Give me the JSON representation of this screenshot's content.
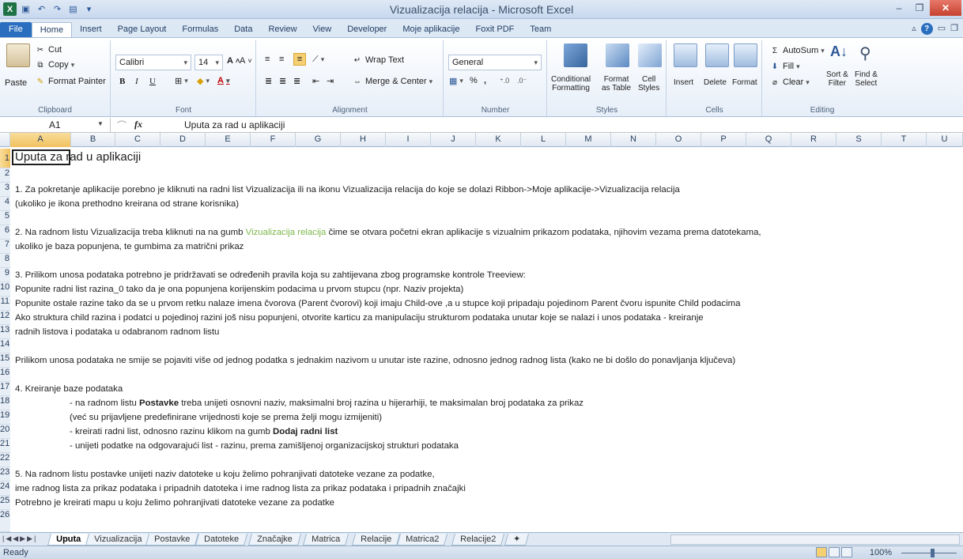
{
  "window": {
    "title": "Vizualizacija relacija  -  Microsoft Excel"
  },
  "ribbon_tabs": [
    "File",
    "Home",
    "Insert",
    "Page Layout",
    "Formulas",
    "Data",
    "Review",
    "View",
    "Developer",
    "Moje aplikacije",
    "Foxit PDF",
    "Team"
  ],
  "active_tab": "Home",
  "clipboard": {
    "paste": "Paste",
    "cut": "Cut",
    "copy": "Copy",
    "format_painter": "Format Painter",
    "label": "Clipboard"
  },
  "font": {
    "name": "Calibri",
    "size": "14",
    "label": "Font",
    "bold": "B",
    "italic": "I",
    "underline": "U"
  },
  "alignment": {
    "wrap_text": "Wrap Text",
    "merge_center": "Merge & Center",
    "label": "Alignment"
  },
  "number": {
    "format": "General",
    "percent": "%",
    "comma": ",",
    "label": "Number"
  },
  "styles": {
    "conditional": "Conditional",
    "conditional2": "Formatting",
    "format_as": "Format",
    "format_as2": "as Table",
    "cell": "Cell",
    "cell2": "Styles",
    "label": "Styles"
  },
  "cells": {
    "insert": "Insert",
    "delete": "Delete",
    "format": "Format",
    "label": "Cells"
  },
  "editing": {
    "autosum": "AutoSum",
    "fill": "Fill",
    "clear": "Clear",
    "sort": "Sort &",
    "sort2": "Filter",
    "find": "Find &",
    "find2": "Select",
    "label": "Editing"
  },
  "formula_bar": {
    "name_box": "A1",
    "fx": "fx",
    "content": "Uputa za rad u aplikaciji"
  },
  "columns": [
    "A",
    "B",
    "C",
    "D",
    "E",
    "F",
    "G",
    "H",
    "I",
    "J",
    "K",
    "L",
    "M",
    "N",
    "O",
    "P",
    "Q",
    "R",
    "S",
    "T",
    "U"
  ],
  "rows": [
    "1",
    "2",
    "3",
    "4",
    "5",
    "6",
    "7",
    "8",
    "9",
    "10",
    "11",
    "12",
    "13",
    "14",
    "15",
    "16",
    "17",
    "18",
    "19",
    "20",
    "21",
    "22",
    "23",
    "24",
    "25",
    "26"
  ],
  "cells_text": {
    "r1": "Uputa za rad u aplikaciji",
    "r3": "1. Za pokretanje aplikacije porebno je kliknuti na radni list Vizualizacija ili na ikonu Vizualizacija relacija do koje se dolazi Ribbon->Moje aplikacije->Vizualizacija relacija",
    "r4": "(ukoliko je ikona prethodno kreirana od strane korisnika)",
    "r6a": "2. Na radnom listu Vizualizacija treba kliknuti na na gumb ",
    "r6b": "Vizualizacija relacija",
    "r6c": " čime se otvara početni ekran aplikacije s vizualnim prikazom podataka, njihovim vezama prema datotekama,",
    "r7": "ukoliko je baza popunjena, te gumbima za matrični prikaz",
    "r9": "3. Prilikom unosa podataka potrebno je pridržavati se određenih pravila koja su zahtijevana zbog programske kontrole Treeview:",
    "r10": "Popunite radni list razina_0 tako da je ona popunjena korijenskim podacima u prvom stupcu (npr. Naziv projekta)",
    "r11": "Popunite ostale razine tako da se u prvom retku nalaze imena čvorova (Parent čvorovi) koji imaju Child-ove ,a u stupce koji pripadaju pojedinom Parent čvoru ispunite Child podacima",
    "r12": "Ako struktura  child razina i podatci u pojedinoj razini još nisu popunjeni, otvorite karticu za manipulaciju strukturom podataka unutar koje se nalazi i unos podataka - kreiranje",
    "r13": "radnih listova i podataka u odabranom radnom listu",
    "r15": "Prilikom unosa podataka ne smije se pojaviti više od jednog podatka s jednakim nazivom u unutar iste razine, odnosno jednog radnog lista (kako ne bi došlo do ponavljanja ključeva)",
    "r17": "4. Kreiranje baze podataka",
    "r18a": "- na radnom listu ",
    "r18b": "Postavke",
    "r18c": " treba unijeti osnovni naziv, maksimalni broj razina u hijerarhiji, te maksimalan broj podataka za prikaz",
    "r19": "(već su prijavljene predefinirane vrijednosti koje se prema želji mogu izmijeniti)",
    "r20a": "- kreirati radni list, odnosno razinu klikom na gumb ",
    "r20b": "Dodaj radni list",
    "r21": "- unijeti podatke na odgovarajući list - razinu, prema zamišljenoj organizacijskoj strukturi podataka",
    "r23": "5. Na radnom listu postavke unijeti naziv datoteke u koju želimo pohranjivati datoteke vezane za podatke,",
    "r24": "ime radnog lista za prikaz podataka i pripadnih datoteka i ime radnog lista za prikaz podataka i pripadnih značajki",
    "r25": "Potrebno je kreirati mapu u koju želimo pohranjivati datoteke vezane za podatke"
  },
  "sheet_tabs": [
    "Uputa",
    "Vizualizacija",
    "Postavke",
    "Datoteke",
    "Značajke",
    "Matrica",
    "Relacije",
    "Matrica2",
    "Relacije2"
  ],
  "active_sheet": "Uputa",
  "status": {
    "ready": "Ready",
    "zoom": "100%"
  },
  "colors": {
    "accent": "#2a6fbf",
    "highlight_text": "#7ab648",
    "selection": "#f1c15f"
  }
}
